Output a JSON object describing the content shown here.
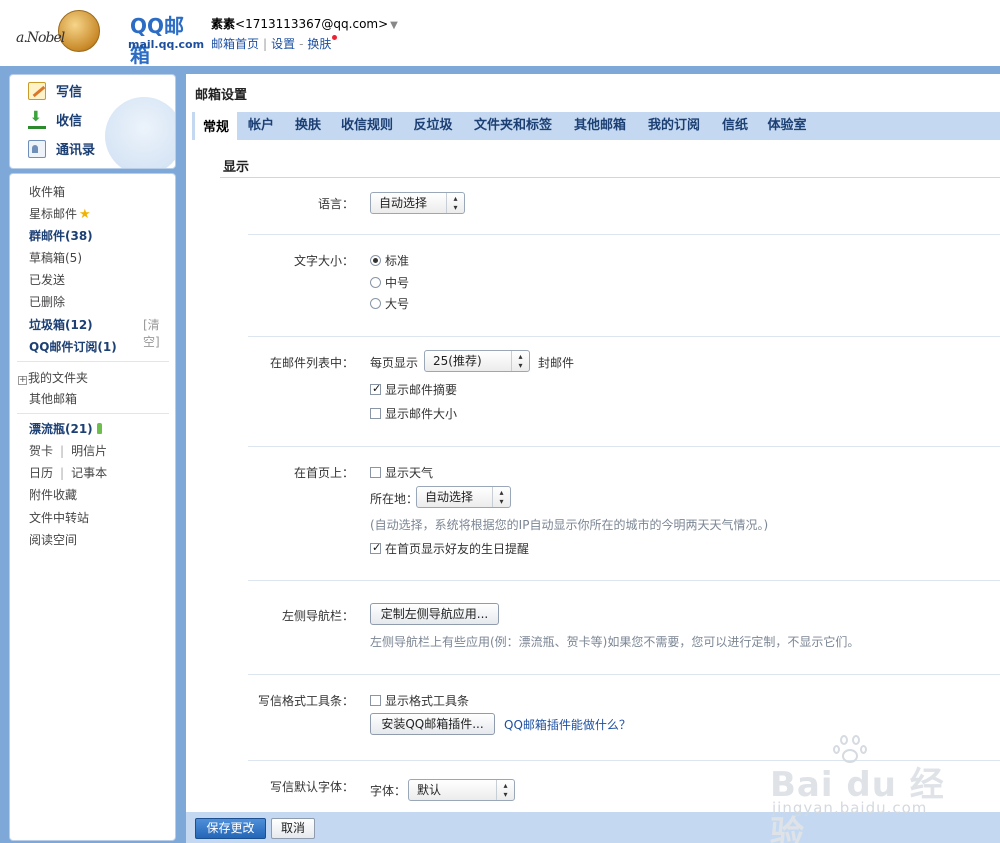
{
  "header": {
    "brand": "QQ邮箱",
    "brand_sub": "mail.qq.com",
    "user_name": "素素",
    "user_email": "<1713113367@qq.com>",
    "links": [
      "邮箱首页",
      "设置",
      "换肤"
    ]
  },
  "quick_actions": {
    "write": "写信",
    "receive": "收信",
    "contacts": "通讯录"
  },
  "folders": {
    "inbox": "收件箱",
    "starred": "星标邮件",
    "group": "群邮件(38)",
    "drafts": "草稿箱(5)",
    "sent": "已发送",
    "deleted": "已删除",
    "spam": "垃圾箱(12)",
    "clear": "[清空]",
    "subscriptions": "QQ邮件订阅(1)",
    "my_folders": "我的文件夹",
    "other_mailbox": "其他邮箱",
    "drift_bottle": "漂流瓶(21)",
    "greeting_card": "贺卡",
    "postcard": "明信片",
    "calendar": "日历",
    "notepad": "记事本",
    "attachments": "附件收藏",
    "file_transfer": "文件中转站",
    "reading_space": "阅读空间"
  },
  "main": {
    "title": "邮箱设置",
    "tabs": [
      "常规",
      "帐户",
      "换肤",
      "收信规则",
      "反垃圾",
      "文件夹和标签",
      "其他邮箱",
      "我的订阅",
      "信纸",
      "体验室"
    ],
    "active_tab": "常规",
    "section_title": "显示"
  },
  "settings": {
    "language": {
      "label": "语言：",
      "value": "自动选择"
    },
    "font_size": {
      "label": "文字大小：",
      "options": [
        "标准",
        "中号",
        "大号"
      ],
      "selected": "标准"
    },
    "list": {
      "label": "在邮件列表中：",
      "per_page_prefix": "每页显示",
      "per_page_value": "25(推荐)",
      "per_page_suffix": "封邮件",
      "show_summary": "显示邮件摘要",
      "show_summary_checked": true,
      "show_size": "显示邮件大小",
      "show_size_checked": false
    },
    "homepage": {
      "label": "在首页上：",
      "show_weather": "显示天气",
      "show_weather_checked": false,
      "location_label": "所在地：",
      "location_value": "自动选择",
      "location_hint": "(自动选择，系统将根据您的IP自动显示你所在的城市的今明两天天气情况。)",
      "show_birthday": "在首页显示好友的生日提醒",
      "show_birthday_checked": true
    },
    "left_nav": {
      "label": "左侧导航栏：",
      "button": "定制左侧导航应用...",
      "hint": "左侧导航栏上有些应用(例：漂流瓶、贺卡等)如果您不需要，您可以进行定制，不显示它们。"
    },
    "toolbar": {
      "label": "写信格式工具条：",
      "show_toolbar": "显示格式工具条",
      "show_toolbar_checked": false,
      "install_button": "安装QQ邮箱插件...",
      "plugin_link": "QQ邮箱插件能做什么？"
    },
    "default_font": {
      "label": "写信默认字体：",
      "font_label": "字体：",
      "font_value": "默认"
    }
  },
  "footer": {
    "save": "保存更改",
    "cancel": "取消"
  },
  "watermark": {
    "text": "Bai du 经验",
    "url": "jingyan.baidu.com"
  }
}
